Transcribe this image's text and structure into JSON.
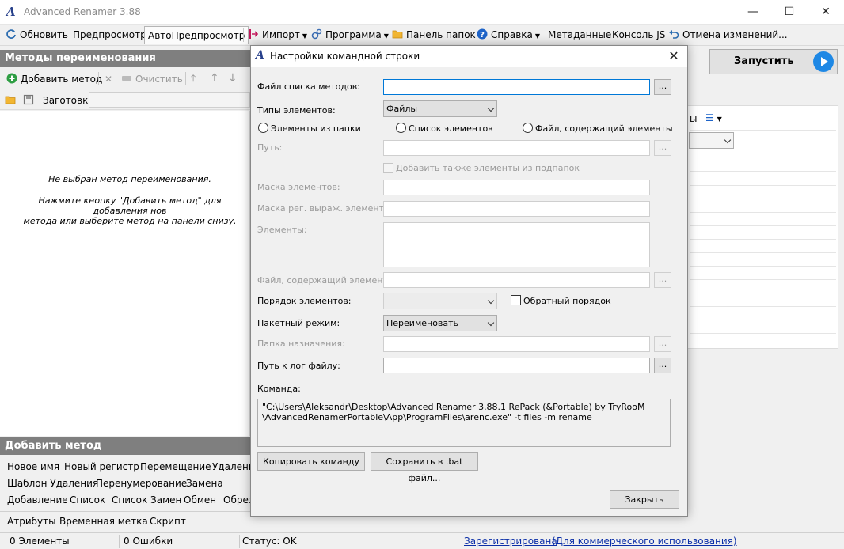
{
  "window": {
    "title": "Advanced Renamer 3.88",
    "logo_text": "A",
    "minimize_glyph": "—",
    "maximize_glyph": "☐",
    "close_glyph": "✕"
  },
  "toolbar": {
    "refresh": "Обновить",
    "preview": "Предпросмотр",
    "auto_preview": "АвтоПредпросмотр",
    "import": "Импорт",
    "program": "Программа",
    "folders_panel": "Панель папок",
    "help": "Справка",
    "metadata": "Метаданные",
    "js_console": "Консоль JS",
    "undo": "Отмена изменений..."
  },
  "left_panel": {
    "header": "Методы переименования",
    "add_method": "Добавить метод",
    "clear": "Очистить",
    "presets_label": "Заготовки:",
    "empty_line1": "Не выбран метод переименования.",
    "empty_line2": "Нажмите кнопку \"Добавить метод\" для добавления нов\nметода или выберите метод на панели снизу."
  },
  "add_method_panel": {
    "header": "Добавить метод",
    "row1": [
      "Новое имя",
      "Новый регистр",
      "Перемещение",
      "Удалени"
    ],
    "row2": [
      "Шаблон Удаления",
      "Перенумерование",
      "Замена"
    ],
    "row3": [
      "Добавление",
      "Список",
      "Список Замен",
      "Обмен",
      "Обрез"
    ],
    "row4": [
      "Атрибуты",
      "Временная метка",
      "Скрипт"
    ]
  },
  "right": {
    "run_button": "Запустить",
    "view_text": "ы"
  },
  "dialog": {
    "title": "Настройки командной строки",
    "close_glyph": "✕",
    "method_list_file": "Файл списка методов:",
    "item_types": "Типы элементов:",
    "item_types_value": "Файлы",
    "radio_folder": "Элементы из папки",
    "radio_list": "Список элементов",
    "radio_file": "Файл, содержащий элементы",
    "path": "Путь:",
    "include_subfolders": "Добавить также элементы из подпапок",
    "item_mask": "Маска элементов:",
    "regex_mask": "Маска рег. выраж. элементов:",
    "items": "Элементы:",
    "items_file": "Файл, содержащий элементы:",
    "item_order": "Порядок элементов:",
    "reverse_order": "Обратный порядок",
    "batch_mode": "Пакетный режим:",
    "batch_mode_value": "Переименовать",
    "dest_folder": "Папка назначения:",
    "log_path": "Путь к лог файлу:",
    "browse": "...",
    "command_label": "Команда:",
    "command_text": "\"C:\\Users\\Aleksandr\\Desktop\\Advanced Renamer 3.88.1 RePack (&Portable) by TryRooM\n\\AdvancedRenamerPortable\\App\\ProgramFiles\\arenc.exe\" -t files -m rename",
    "copy_command": "Копировать команду",
    "save_bat": "Сохранить в .bat файл...",
    "close_button": "Закрыть"
  },
  "status": {
    "elements": "0 Элементы",
    "errors": "0 Ошибки",
    "status": "Статус: OK",
    "registered": "Зарегистрирована",
    "commercial": "(Для коммерческого использования)"
  },
  "colors": {
    "accent": "#0078d7",
    "header_gray": "#7f7f7f",
    "run_blue": "#1e88e5",
    "link": "#0b2fa8"
  }
}
